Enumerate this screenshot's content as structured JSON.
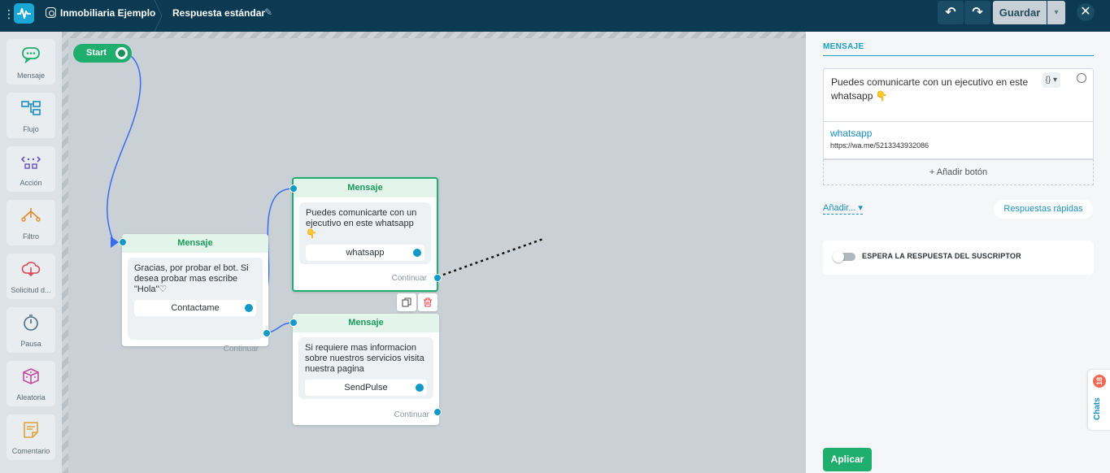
{
  "topbar": {
    "account": "Inmobiliaria Ejemplo",
    "flow_name": "Respuesta estándar",
    "undo_icon": "↶",
    "redo_icon": "↷",
    "save_label": "Guardar",
    "close_icon": "✕"
  },
  "sidebar": {
    "items": [
      {
        "label": "Mensaje",
        "icon": "chat-bubble-icon",
        "color": "#1fae6d"
      },
      {
        "label": "Flujo",
        "icon": "flow-icon",
        "color": "#1a8fc2"
      },
      {
        "label": "Acción",
        "icon": "action-icon",
        "color": "#6a4fc7"
      },
      {
        "label": "Filtro",
        "icon": "filter-icon",
        "color": "#e08b2a"
      },
      {
        "label": "Solicitud d...",
        "icon": "cloud-request-icon",
        "color": "#d94a5a"
      },
      {
        "label": "Pausa",
        "icon": "stopwatch-icon",
        "color": "#4a6f82"
      },
      {
        "label": "Aleatoria",
        "icon": "dice-icon",
        "color": "#c44aa0"
      },
      {
        "label": "Comentario",
        "icon": "note-icon",
        "color": "#e0a23a"
      }
    ]
  },
  "canvas": {
    "start_label": "Start",
    "nodes": [
      {
        "title": "Mensaje",
        "text": "Gracias, por probar el bot. Si desea probar mas escribe \"Hola\"♡",
        "button": "Contactame",
        "footer": "Continuar"
      },
      {
        "title": "Mensaje",
        "text": "Puedes comunicarte con un ejecutivo en este whatsapp 👇",
        "button": "whatsapp",
        "footer": "Continuar"
      },
      {
        "title": "Mensaje",
        "text": "Si requiere mas informacion sobre nuestros servicios visita nuestra pagina",
        "button": "SendPulse",
        "footer": "Continuar"
      }
    ]
  },
  "panel": {
    "title": "MENSAJE",
    "message": "Puedes comunicarte con un ejecutivo en este whatsapp 👇",
    "variables_tool": "{} ▾",
    "button_title": "whatsapp",
    "button_url": "https://wa.me/5213343932086",
    "add_button": "+ Añadir botón",
    "add_dropdown": "Añadir...",
    "quick_replies": "Respuestas rápidas",
    "wait_label": "ESPERA LA RESPUESTA DEL SUSCRIPTOR",
    "apply_label": "Aplicar",
    "chats_label": "Chats",
    "chats_count": "18"
  },
  "colors": {
    "topbar": "#0b3a52",
    "accent_green": "#1fae6d",
    "accent_blue": "#1299c5",
    "wire_blue": "#3a6cf0"
  }
}
